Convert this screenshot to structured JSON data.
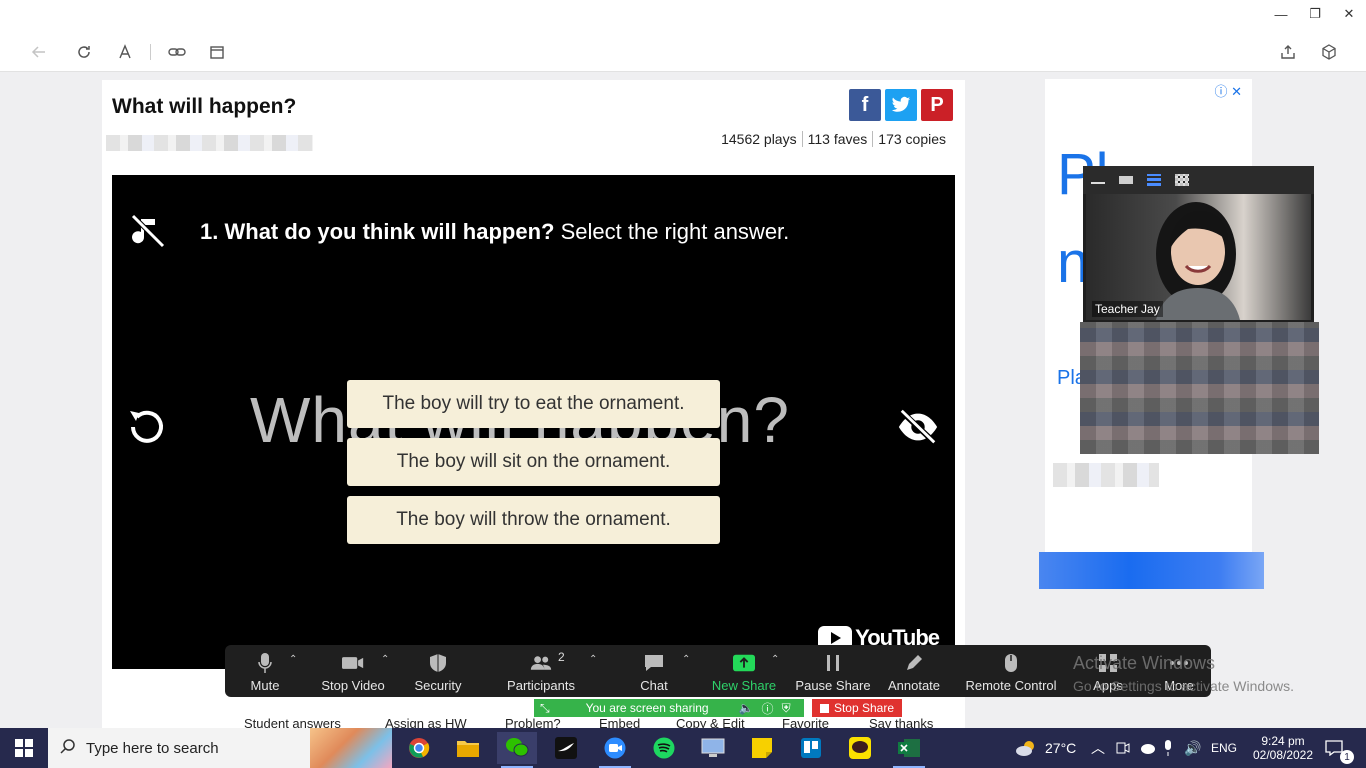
{
  "window": {
    "minimize_label": "—",
    "restore_label": "❐",
    "close_label": "✕"
  },
  "page": {
    "title": "What will happen?",
    "stats": {
      "plays": "14562 plays",
      "faves": "113 faves",
      "copies": "173 copies"
    },
    "share": [
      {
        "name": "facebook",
        "label": "f",
        "color": "#3b5998"
      },
      {
        "name": "twitter",
        "label": "t",
        "color": "#1da1f2"
      },
      {
        "name": "pinterest",
        "label": "P",
        "color": "#cb2027"
      }
    ]
  },
  "video": {
    "question_number": "1.",
    "question_bold": "What do you think will happen?",
    "question_rest": "Select the right answer.",
    "background_title": "What will happen?",
    "answers": [
      "The boy will try to eat the ornament.",
      "The boy will sit on the ornament.",
      "The boy will throw the ornament."
    ],
    "youtube_label": "YouTube"
  },
  "below_video": {
    "student_answers": "Student answers",
    "assign_hw": "Assign as HW",
    "problem": "Problem?",
    "embed": "Embed",
    "copy_edit": "Copy & Edit",
    "favorite": "Favorite",
    "say_thanks": "Say thanks"
  },
  "ad": {
    "letters_top": "Pl",
    "letters_mid": "n",
    "letters_bottom": "Pla"
  },
  "zoom": {
    "teacher_name": "Teacher Jay",
    "toolbar": {
      "mute": "Mute",
      "stop_video": "Stop Video",
      "security": "Security",
      "participants": "Participants",
      "participants_count": "2",
      "chat": "Chat",
      "new_share": "New Share",
      "pause_share": "Pause Share",
      "annotate": "Annotate",
      "remote_control": "Remote Control",
      "apps": "Apps",
      "more": "More"
    },
    "sharing_banner": "You are screen sharing",
    "stop_share": "Stop Share",
    "new_share_color": "#23d959"
  },
  "watermark": {
    "title": "Activate Windows",
    "subtitle": "Go to Settings to activate Windows."
  },
  "taskbar": {
    "search_placeholder": "Type here to search",
    "temperature": "27°C",
    "language": "ENG",
    "time": "9:24 pm",
    "date": "02/08/2022",
    "notification_count": "1"
  }
}
